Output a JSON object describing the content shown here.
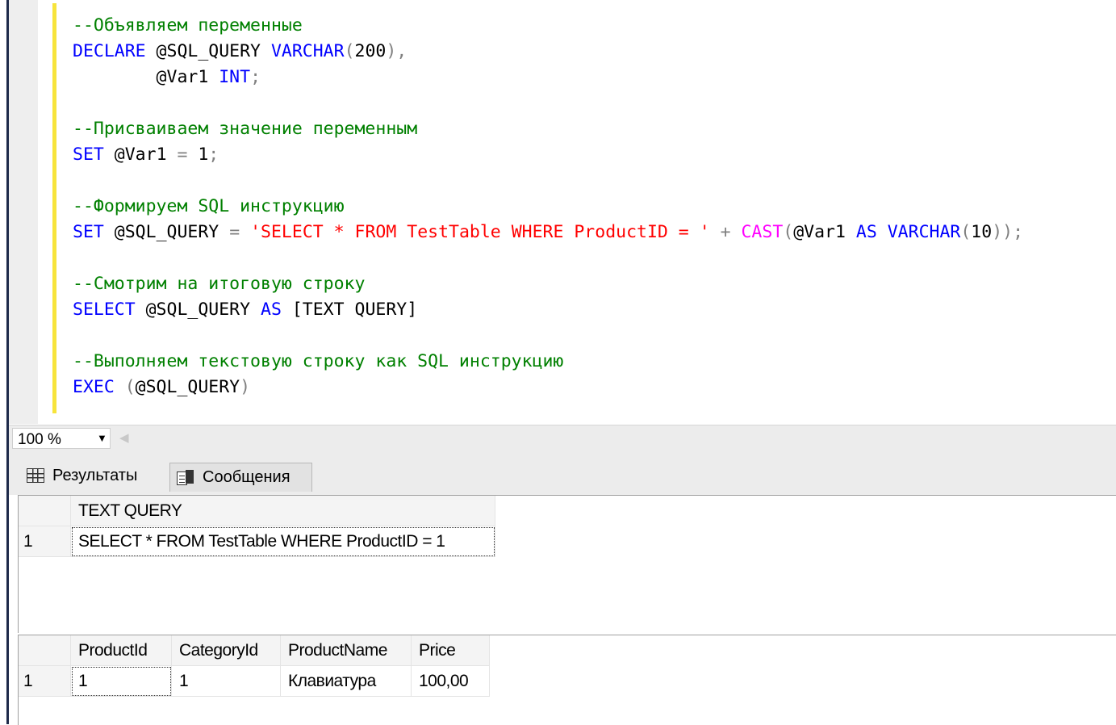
{
  "editor": {
    "lines": [
      [
        {
          "t": "--Объявляем переменные",
          "c": "cm"
        }
      ],
      [
        {
          "t": "DECLARE",
          "c": "kw"
        },
        {
          "t": " @SQL_QUERY ",
          "c": ""
        },
        {
          "t": "VARCHAR",
          "c": "kw"
        },
        {
          "t": "(",
          "c": "op"
        },
        {
          "t": "200",
          "c": ""
        },
        {
          "t": "),",
          "c": "op"
        }
      ],
      [
        {
          "t": "        @Var1 ",
          "c": ""
        },
        {
          "t": "INT",
          "c": "kw"
        },
        {
          "t": ";",
          "c": "op"
        }
      ],
      [],
      [
        {
          "t": "--Присваиваем значение переменным",
          "c": "cm"
        }
      ],
      [
        {
          "t": "SET",
          "c": "kw"
        },
        {
          "t": " @Var1 ",
          "c": ""
        },
        {
          "t": "=",
          "c": "op"
        },
        {
          "t": " 1",
          "c": ""
        },
        {
          "t": ";",
          "c": "op"
        }
      ],
      [],
      [
        {
          "t": "--Формируем SQL инструкцию",
          "c": "cm"
        }
      ],
      [
        {
          "t": "SET",
          "c": "kw"
        },
        {
          "t": " @SQL_QUERY ",
          "c": ""
        },
        {
          "t": "=",
          "c": "op"
        },
        {
          "t": " ",
          "c": ""
        },
        {
          "t": "'SELECT * FROM TestTable WHERE ProductID = '",
          "c": "str"
        },
        {
          "t": " + ",
          "c": "op"
        },
        {
          "t": "CAST",
          "c": "fn"
        },
        {
          "t": "(",
          "c": "op"
        },
        {
          "t": "@Var1 ",
          "c": ""
        },
        {
          "t": "AS",
          "c": "kw"
        },
        {
          "t": " ",
          "c": ""
        },
        {
          "t": "VARCHAR",
          "c": "kw"
        },
        {
          "t": "(",
          "c": "op"
        },
        {
          "t": "10",
          "c": ""
        },
        {
          "t": "));",
          "c": "op"
        }
      ],
      [],
      [
        {
          "t": "--Смотрим на итоговую строку",
          "c": "cm"
        }
      ],
      [
        {
          "t": "SELECT",
          "c": "kw"
        },
        {
          "t": " @SQL_QUERY ",
          "c": ""
        },
        {
          "t": "AS",
          "c": "kw"
        },
        {
          "t": " [TEXT QUERY]",
          "c": ""
        }
      ],
      [],
      [
        {
          "t": "--Выполняем текстовую строку как SQL инструкцию",
          "c": "cm"
        }
      ],
      [
        {
          "t": "EXEC",
          "c": "kw"
        },
        {
          "t": " (",
          "c": "op"
        },
        {
          "t": "@SQL_QUERY",
          "c": ""
        },
        {
          "t": ")",
          "c": "op"
        }
      ]
    ]
  },
  "zoom": {
    "value": "100 %"
  },
  "tabs": {
    "results_label": "Результаты",
    "messages_label": "Сообщения"
  },
  "grid1": {
    "columns": [
      "TEXT QUERY"
    ],
    "rows": [
      {
        "num": "1",
        "cells": [
          "SELECT * FROM TestTable WHERE ProductID = 1"
        ]
      }
    ]
  },
  "grid2": {
    "columns": [
      "ProductId",
      "CategoryId",
      "ProductName",
      "Price"
    ],
    "rows": [
      {
        "num": "1",
        "cells": [
          "1",
          "1",
          "Клавиатура",
          "100,00"
        ]
      }
    ]
  },
  "colors": {
    "comment": "#008000",
    "keyword": "#0000ff",
    "string": "#ff0000",
    "function": "#ff00ff",
    "operator": "#808080",
    "change_bar": "#f7e43b"
  }
}
